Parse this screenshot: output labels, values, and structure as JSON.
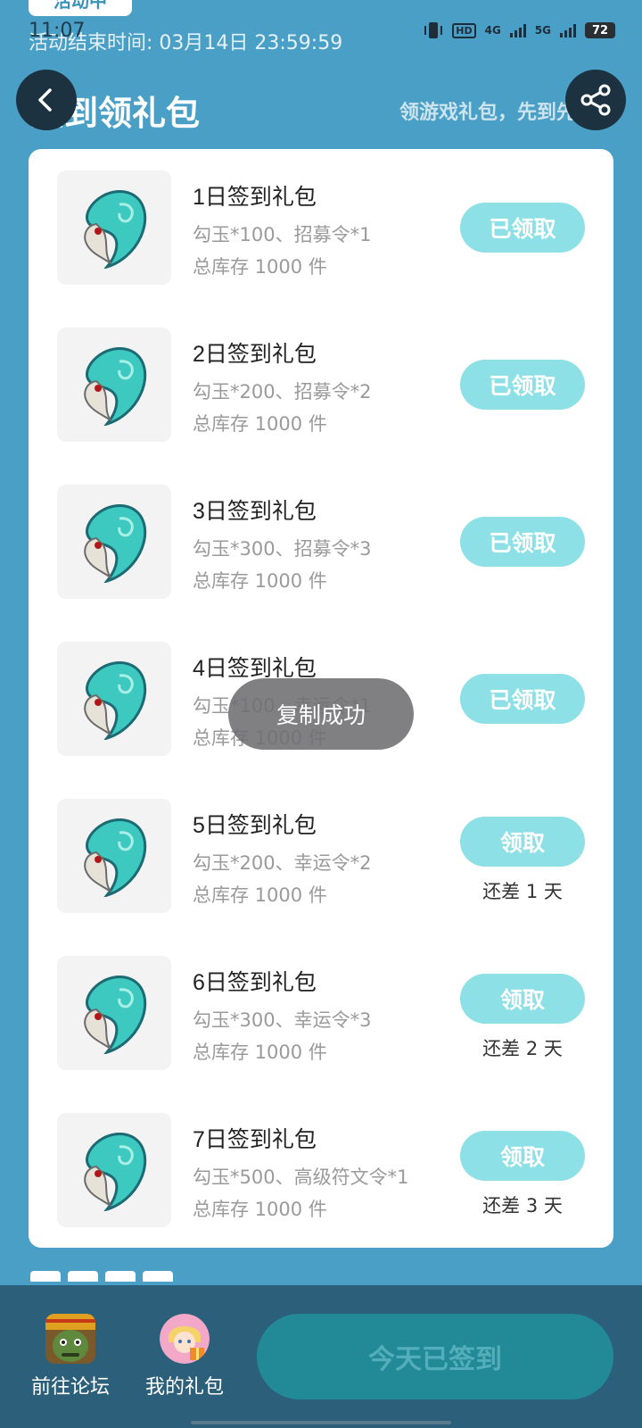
{
  "status_bar": {
    "time": "11:07",
    "network_4g": "4G",
    "network_5g": "5G",
    "hd_badge": "HD",
    "battery": "72"
  },
  "event": {
    "tag": "活动中",
    "end_time": "活动结束时间: 03月14日 23:59:59"
  },
  "header": {
    "title": "签到领礼包",
    "subtitle": "领游戏礼包，先到先得",
    "back_icon": "chevron-left-icon",
    "share_icon": "share-icon"
  },
  "gifts": [
    {
      "title": "1日签到礼包",
      "items": "勾玉*100、招募令*1",
      "stock": "总库存 1000 件",
      "button": "已领取",
      "days_left": ""
    },
    {
      "title": "2日签到礼包",
      "items": "勾玉*200、招募令*2",
      "stock": "总库存 1000 件",
      "button": "已领取",
      "days_left": ""
    },
    {
      "title": "3日签到礼包",
      "items": "勾玉*300、招募令*3",
      "stock": "总库存 1000 件",
      "button": "已领取",
      "days_left": ""
    },
    {
      "title": "4日签到礼包",
      "items": "勾玉*100、幸运令*1",
      "stock": "总库存 1000 件",
      "button": "已领取",
      "days_left": ""
    },
    {
      "title": "5日签到礼包",
      "items": "勾玉*200、幸运令*2",
      "stock": "总库存 1000 件",
      "button": "领取",
      "days_left": "还差 1 天"
    },
    {
      "title": "6日签到礼包",
      "items": "勾玉*300、幸运令*3",
      "stock": "总库存 1000 件",
      "button": "领取",
      "days_left": "还差 2 天"
    },
    {
      "title": "7日签到礼包",
      "items": "勾玉*500、高级符文令*1",
      "stock": "总库存 1000 件",
      "button": "领取",
      "days_left": "还差 3 天"
    }
  ],
  "toast": "复制成功",
  "bottom_nav": {
    "forum_label": "前往论坛",
    "my_gifts_label": "我的礼包",
    "signed_button": "今天已签到"
  },
  "colors": {
    "background": "#4a9fc6",
    "button_claim": "#8de0e6",
    "bottom_bar": "#2c5f7a",
    "signed_button": "#228a96"
  }
}
